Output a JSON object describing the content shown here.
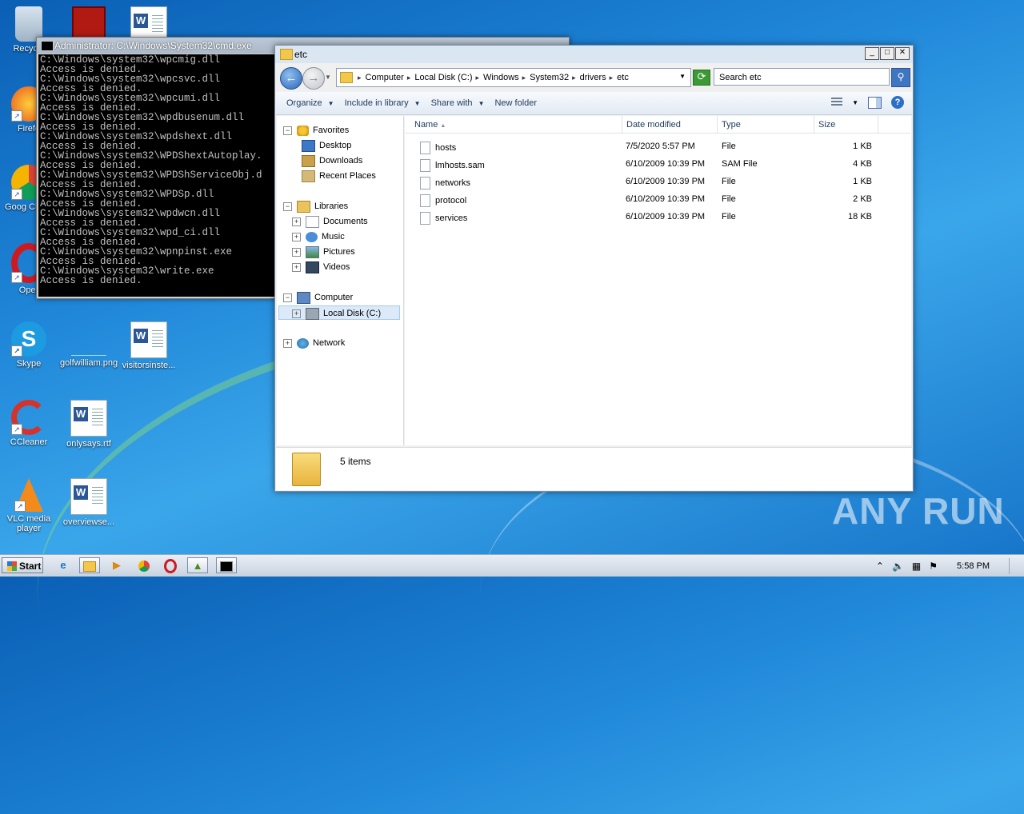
{
  "desktop": {
    "icons": [
      {
        "label": "Recycle"
      },
      {
        "label": "Firefo"
      },
      {
        "label": "Goog Chron"
      },
      {
        "label": "Oper"
      },
      {
        "label": "Skype"
      },
      {
        "label": "golfwilliam.png"
      },
      {
        "label": "visitorsinste..."
      },
      {
        "label": "CCleaner"
      },
      {
        "label": "onlysays.rtf"
      },
      {
        "label": "VLC media player"
      },
      {
        "label": "overviewse..."
      }
    ]
  },
  "cmd": {
    "title": "Administrator: C:\\Windows\\System32\\cmd.exe",
    "lines": [
      "C:\\Windows\\system32\\wpcmig.dll",
      "Access is denied.",
      "C:\\Windows\\system32\\wpcsvc.dll",
      "Access is denied.",
      "C:\\Windows\\system32\\wpcumi.dll",
      "Access is denied.",
      "C:\\Windows\\system32\\wpdbusenum.dll",
      "Access is denied.",
      "C:\\Windows\\system32\\wpdshext.dll",
      "Access is denied.",
      "C:\\Windows\\system32\\WPDShextAutoplay.",
      "Access is denied.",
      "C:\\Windows\\system32\\WPDShServiceObj.d",
      "Access is denied.",
      "C:\\Windows\\system32\\WPDSp.dll",
      "Access is denied.",
      "C:\\Windows\\system32\\wpdwcn.dll",
      "Access is denied.",
      "C:\\Windows\\system32\\wpd_ci.dll",
      "Access is denied.",
      "C:\\Windows\\system32\\wpnpinst.exe",
      "Access is denied.",
      "C:\\Windows\\system32\\write.exe",
      "Access is denied."
    ]
  },
  "explorer": {
    "title": "etc",
    "breadcrumbs": [
      "Computer",
      "Local Disk (C:)",
      "Windows",
      "System32",
      "drivers",
      "etc"
    ],
    "search_placeholder": "Search etc",
    "toolbar": {
      "organize": "Organize",
      "include": "Include in library",
      "share": "Share with",
      "new_folder": "New folder"
    },
    "nav": {
      "favorites": "Favorites",
      "desktop": "Desktop",
      "downloads": "Downloads",
      "recent": "Recent Places",
      "libraries": "Libraries",
      "documents": "Documents",
      "music": "Music",
      "pictures": "Pictures",
      "videos": "Videos",
      "computer": "Computer",
      "local_disk": "Local Disk (C:)",
      "network": "Network"
    },
    "columns": {
      "name": "Name",
      "date": "Date modified",
      "type": "Type",
      "size": "Size"
    },
    "files": [
      {
        "name": "hosts",
        "date": "7/5/2020 5:57 PM",
        "type": "File",
        "size": "1 KB"
      },
      {
        "name": "lmhosts.sam",
        "date": "6/10/2009 10:39 PM",
        "type": "SAM File",
        "size": "4 KB"
      },
      {
        "name": "networks",
        "date": "6/10/2009 10:39 PM",
        "type": "File",
        "size": "1 KB"
      },
      {
        "name": "protocol",
        "date": "6/10/2009 10:39 PM",
        "type": "File",
        "size": "2 KB"
      },
      {
        "name": "services",
        "date": "6/10/2009 10:39 PM",
        "type": "File",
        "size": "18 KB"
      }
    ],
    "item_count": "5 items"
  },
  "taskbar": {
    "start_label": "Start",
    "clock": "5:58 PM"
  },
  "watermark": "ANY RUN"
}
